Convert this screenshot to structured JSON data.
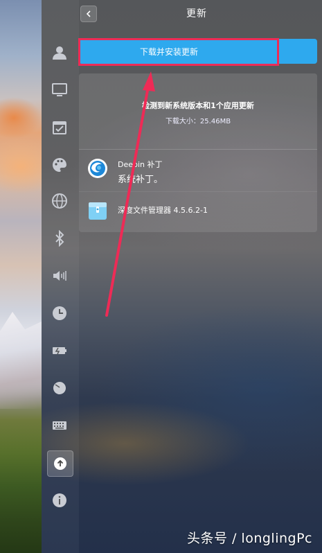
{
  "header": {
    "title": "更新",
    "back_icon": "chevron-left-icon"
  },
  "sidebar": {
    "items": [
      {
        "name": "accounts",
        "icon": "user-icon"
      },
      {
        "name": "display",
        "icon": "monitor-icon"
      },
      {
        "name": "default-apps",
        "icon": "calendar-check-icon"
      },
      {
        "name": "personalization",
        "icon": "palette-icon"
      },
      {
        "name": "network",
        "icon": "globe-icon"
      },
      {
        "name": "bluetooth",
        "icon": "bluetooth-icon"
      },
      {
        "name": "sound",
        "icon": "speaker-icon"
      },
      {
        "name": "time",
        "icon": "clock-icon"
      },
      {
        "name": "power",
        "icon": "battery-icon"
      },
      {
        "name": "mouse",
        "icon": "mouse-icon"
      },
      {
        "name": "keyboard",
        "icon": "keyboard-icon"
      },
      {
        "name": "update",
        "icon": "update-arrow-icon",
        "active": true
      },
      {
        "name": "system-info",
        "icon": "info-icon"
      }
    ]
  },
  "main": {
    "download_button": "下载并安装更新",
    "summary": {
      "title": "检测到新系统版本和1个应用更新",
      "size": "下载大小：25.46MB"
    },
    "updates": [
      {
        "name": "Deepin 补丁",
        "description": "系统补丁。",
        "icon": "deepin-logo-icon"
      },
      {
        "name": "深度文件管理器 4.5.6.2-1",
        "description": "",
        "icon": "file-manager-icon"
      }
    ]
  },
  "watermark": "头条号 / longlingPc",
  "colors": {
    "accent": "#2ea9ee",
    "annotation": "#ee2b56"
  }
}
